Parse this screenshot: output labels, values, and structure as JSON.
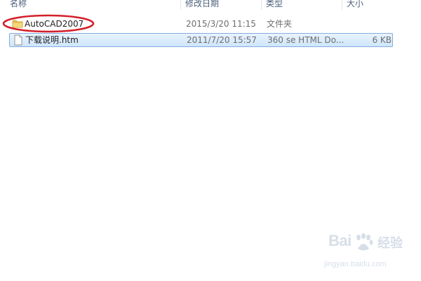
{
  "columns": {
    "name": "名称",
    "date": "修改日期",
    "type": "类型",
    "size": "大小"
  },
  "files": [
    {
      "name": "AutoCAD2007",
      "date": "2015/3/20 11:15",
      "type": "文件夹",
      "size": "",
      "icon": "folder-icon",
      "selected": false,
      "highlighted": true
    },
    {
      "name": "下载说明.htm",
      "date": "2011/7/20 15:57",
      "type": "360 se HTML Do...",
      "size": "6 KB",
      "icon": "html-file-icon",
      "selected": true,
      "highlighted": false
    }
  ],
  "annotation": {
    "color": "#d3202a"
  },
  "watermark": {
    "brand": "Bai",
    "service": "经验",
    "url": "jingyan.baidu.com"
  },
  "colors": {
    "header_text": "#4c607a",
    "selection_border": "#84acdd",
    "selection_fill": "#cfe6fc",
    "folder": "#e8c25a"
  }
}
